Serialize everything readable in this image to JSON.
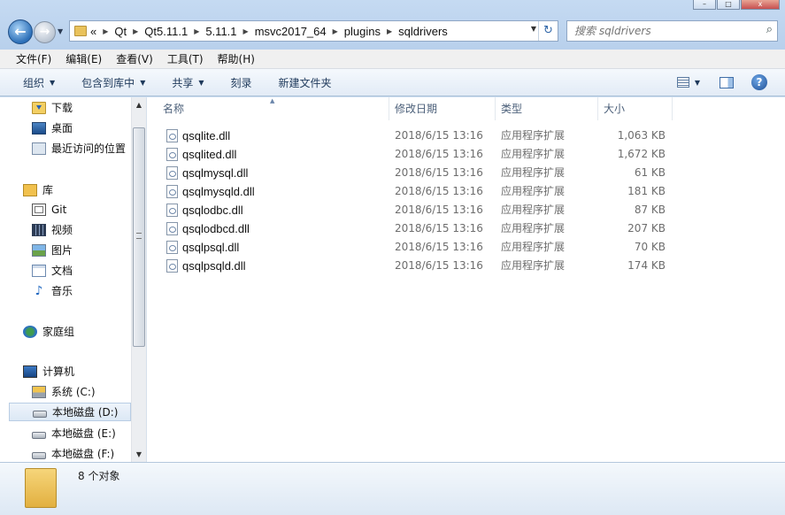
{
  "window": {
    "controls": [
      "–",
      "□",
      "x"
    ]
  },
  "nav": {
    "back": "←",
    "forward": "→",
    "dropdown": "▼"
  },
  "address": {
    "overflow": "«",
    "crumbs": [
      "Qt",
      "Qt5.11.1",
      "5.11.1",
      "msvc2017_64",
      "plugins",
      "sqldrivers"
    ],
    "separator": "▶",
    "dropdown": "▼",
    "refresh_icon": "↻"
  },
  "search": {
    "placeholder": "搜索 sqldrivers",
    "icon": "⌕"
  },
  "menu": [
    "文件(F)",
    "编辑(E)",
    "查看(V)",
    "工具(T)",
    "帮助(H)"
  ],
  "commands": [
    {
      "label": "组织",
      "arrow": "▼"
    },
    {
      "label": "包含到库中",
      "arrow": "▼"
    },
    {
      "label": "共享",
      "arrow": "▼"
    },
    {
      "label": "刻录",
      "arrow": ""
    },
    {
      "label": "新建文件夹",
      "arrow": ""
    }
  ],
  "command_right": {
    "view_arrow": "▼",
    "help": "?"
  },
  "sidebar": {
    "items": [
      {
        "label": "下载",
        "icon": "download-folder-icon"
      },
      {
        "label": "桌面",
        "icon": "desktop-icon"
      },
      {
        "label": "最近访问的位置",
        "icon": "recent-places-icon"
      },
      {
        "label": "库",
        "icon": "libraries-icon"
      },
      {
        "label": "Git",
        "icon": "git-library-icon"
      },
      {
        "label": "视频",
        "icon": "videos-icon"
      },
      {
        "label": "图片",
        "icon": "pictures-icon"
      },
      {
        "label": "文档",
        "icon": "documents-icon"
      },
      {
        "label": "音乐",
        "icon": "music-icon"
      },
      {
        "label": "家庭组",
        "icon": "homegroup-icon"
      },
      {
        "label": "计算机",
        "icon": "computer-icon"
      },
      {
        "label": "系统 (C:)",
        "icon": "system-drive-icon"
      },
      {
        "label": "本地磁盘 (D:)",
        "icon": "drive-icon"
      },
      {
        "label": "本地磁盘 (E:)",
        "icon": "drive-icon"
      },
      {
        "label": "本地磁盘 (F:)",
        "icon": "drive-icon"
      }
    ],
    "selected": "本地磁盘 (D:)",
    "scroll_up": "▲",
    "scroll_down": "▼"
  },
  "columns": {
    "name": "名称",
    "date": "修改日期",
    "type": "类型",
    "size": "大小",
    "sort_indicator": "▲"
  },
  "files": [
    {
      "name": "qsqlite.dll",
      "date": "2018/6/15 13:16",
      "type": "应用程序扩展",
      "size": "1,063 KB"
    },
    {
      "name": "qsqlited.dll",
      "date": "2018/6/15 13:16",
      "type": "应用程序扩展",
      "size": "1,672 KB"
    },
    {
      "name": "qsqlmysql.dll",
      "date": "2018/6/15 13:16",
      "type": "应用程序扩展",
      "size": "61 KB"
    },
    {
      "name": "qsqlmysqld.dll",
      "date": "2018/6/15 13:16",
      "type": "应用程序扩展",
      "size": "181 KB"
    },
    {
      "name": "qsqlodbc.dll",
      "date": "2018/6/15 13:16",
      "type": "应用程序扩展",
      "size": "87 KB"
    },
    {
      "name": "qsqlodbcd.dll",
      "date": "2018/6/15 13:16",
      "type": "应用程序扩展",
      "size": "207 KB"
    },
    {
      "name": "qsqlpsql.dll",
      "date": "2018/6/15 13:16",
      "type": "应用程序扩展",
      "size": "70 KB"
    },
    {
      "name": "qsqlpsqld.dll",
      "date": "2018/6/15 13:16",
      "type": "应用程序扩展",
      "size": "174 KB"
    }
  ],
  "status": {
    "text": "8 个对象"
  },
  "colors": {
    "accent": "#1e395b",
    "selection": "#dce8f5",
    "chrome": "#cfe0f2"
  }
}
